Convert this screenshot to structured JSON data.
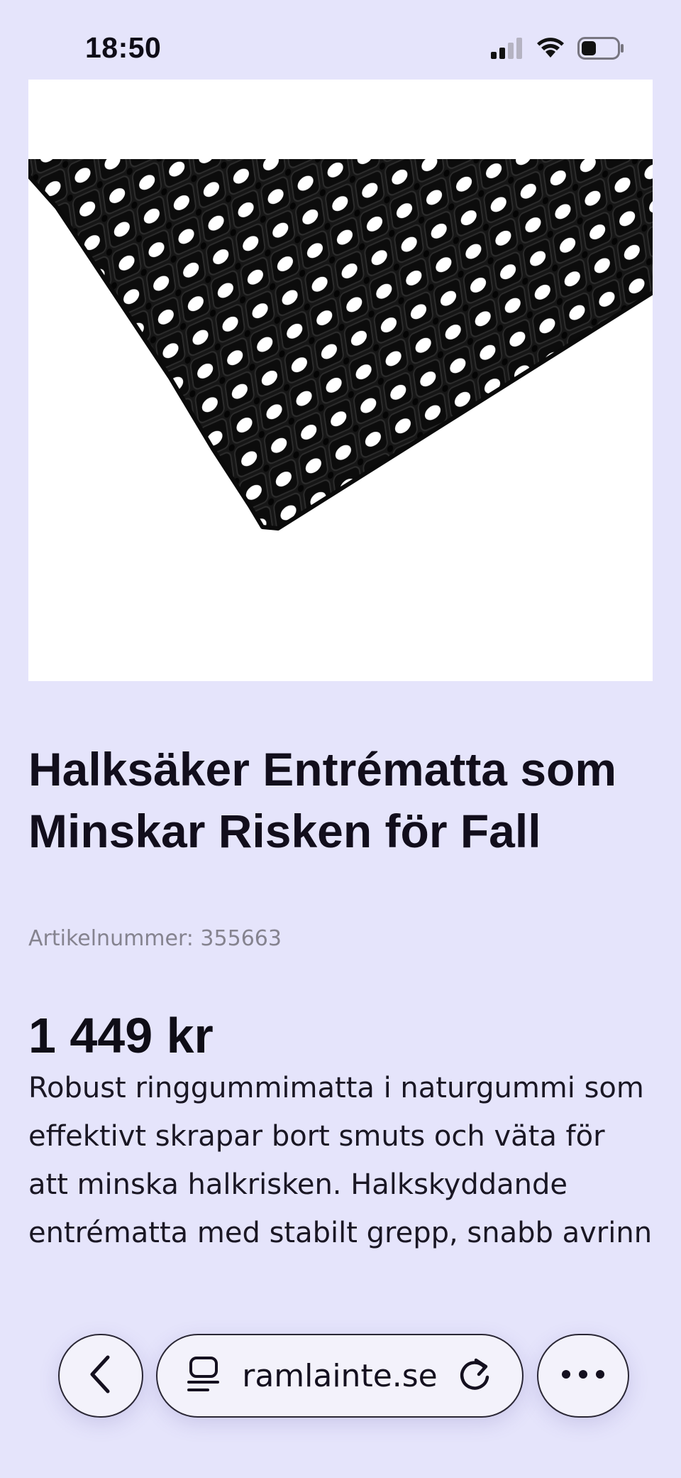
{
  "status_bar": {
    "time": "18:50",
    "icons": [
      "cellular-signal-icon",
      "wifi-icon",
      "battery-icon"
    ]
  },
  "product": {
    "image": "rubber-ring-mat-image",
    "title": "Halksäker Entrématta som Minskar Risken för Fall",
    "article_number": "Artikelnummer: 355663",
    "price": "1 449 kr",
    "description": "Robust ringgummimatta i naturgummi som effektivt skrapar bort smuts och väta för att minska halkrisken. Halkskyddande entrématta med stabilt grepp, snabb avrinn"
  },
  "browser_bar": {
    "back_icon": "chevron-left-icon",
    "page_icon": "page-menu-icon",
    "url": "ramlainte.se",
    "reload_icon": "reload-icon",
    "more_icon": "more-dots-icon"
  },
  "colors": {
    "background": "#e5e4fb",
    "text": "#14101f",
    "muted_text": "#85838f",
    "mat": "#141414",
    "image_bg": "#ffffff"
  }
}
